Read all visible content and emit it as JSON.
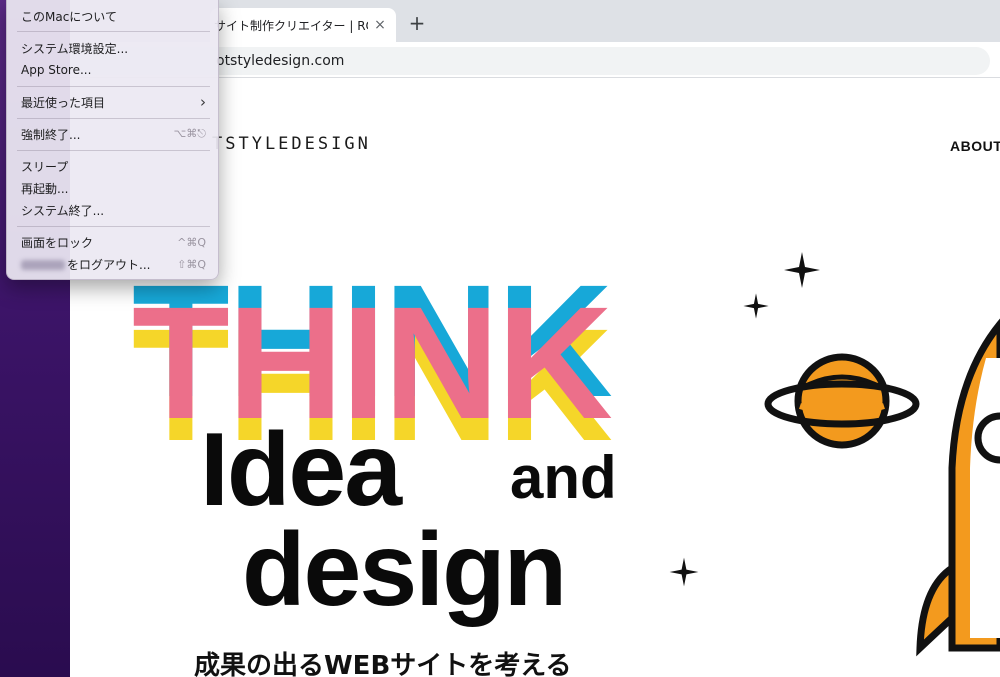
{
  "browser": {
    "tab": {
      "title": "サイト制作クリエイター | RO",
      "close_icon": "×"
    },
    "new_tab_icon": "+",
    "address": "otstyledesign.com"
  },
  "site": {
    "logo": "TSTYLEDESIGN",
    "nav": {
      "about": "ABOUT"
    },
    "hero": {
      "think": "THINK",
      "idea": "Idea",
      "and": "and",
      "design": "design",
      "tagline": "成果の出るWEBサイトを考える"
    },
    "colors": {
      "pink": "#ec6f8a",
      "blue": "#17a8d8",
      "yellow": "#f5d629",
      "orange": "#f39a1e",
      "black": "#0a0a0a"
    }
  },
  "apple_menu": {
    "items": [
      {
        "label": "このMacについて",
        "shortcut": ""
      },
      {
        "label": "システム環境設定...",
        "shortcut": ""
      },
      {
        "label": "App Store...",
        "shortcut": ""
      },
      {
        "label": "最近使った項目",
        "shortcut": "›"
      },
      {
        "label": "強制終了...",
        "shortcut": "⌥⌘⎋"
      },
      {
        "label": "スリープ",
        "shortcut": ""
      },
      {
        "label": "再起動...",
        "shortcut": ""
      },
      {
        "label": "システム終了...",
        "shortcut": ""
      },
      {
        "label": "画面をロック",
        "shortcut": "^⌘Q"
      },
      {
        "label": "をログアウト...",
        "shortcut": "⇧⌘Q"
      }
    ]
  }
}
